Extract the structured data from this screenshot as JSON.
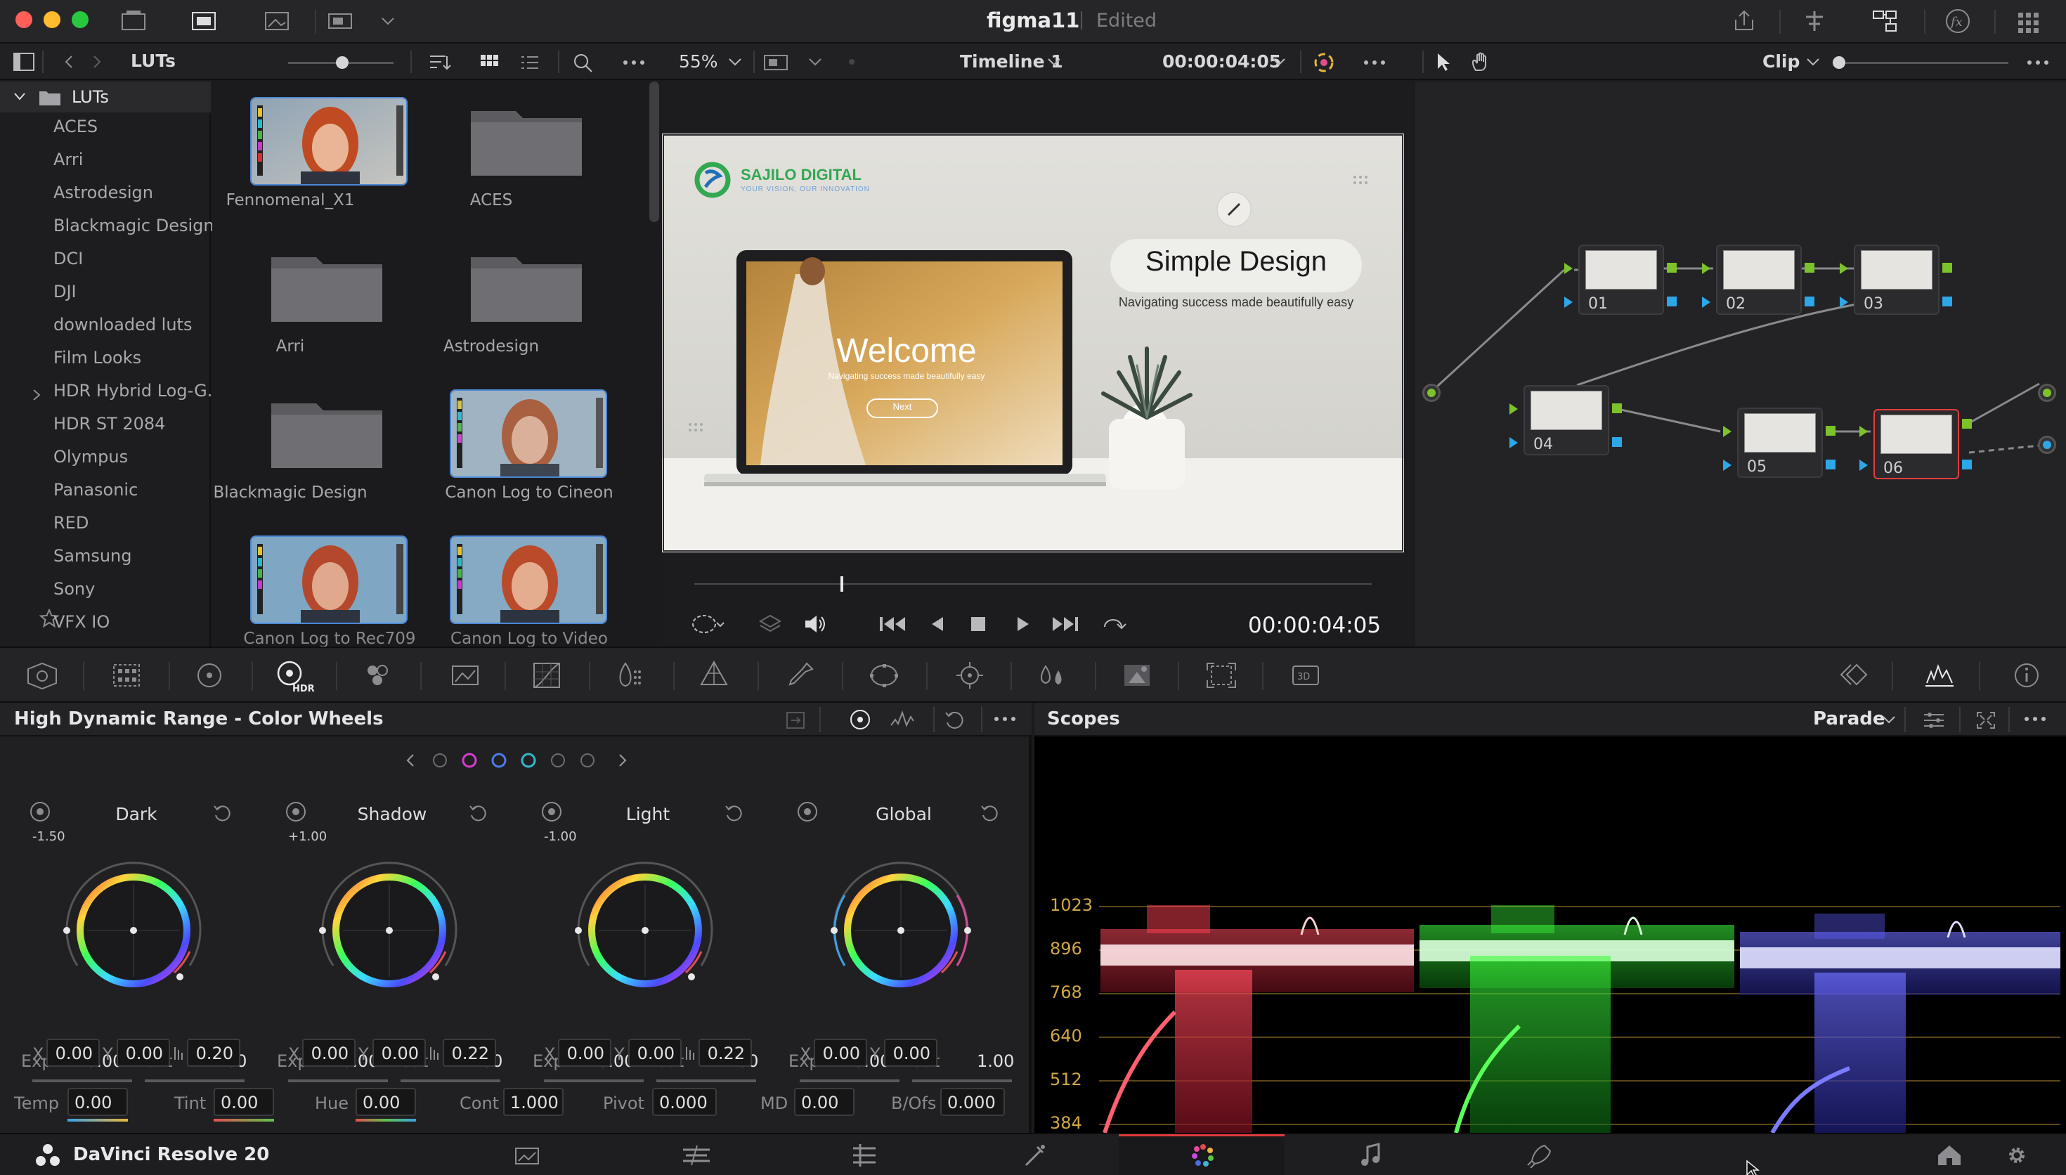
{
  "window": {
    "title": "figma11",
    "status": "Edited"
  },
  "browser": {
    "panel_title": "LUTs",
    "tree_root": "LUTs",
    "tree_items": [
      "ACES",
      "Arri",
      "Astrodesign",
      "Blackmagic Design",
      "DCI",
      "DJI",
      "downloaded luts",
      "Film Looks",
      "HDR Hybrid Log-G...",
      "HDR ST 2084",
      "Olympus",
      "Panasonic",
      "RED",
      "Samsung",
      "Sony",
      "VFX IO",
      "Favorites"
    ],
    "grid_items": [
      "Fennomenal_X1",
      "ACES",
      "Arri",
      "Astrodesign",
      "Blackmagic Design",
      "Canon Log to Cineon",
      "Canon Log to Rec709",
      "Canon Log to Video"
    ]
  },
  "viewer": {
    "zoom": "55%",
    "timeline": "Timeline 1",
    "timecode": "00:00:04:05",
    "playback_timecode": "00:00:04:05",
    "frame": {
      "brand": "SAJILO DIGITAL",
      "tagline": "YOUR VISION, OUR INNOVATION",
      "headline": "Simple Design",
      "subline": "Navigating success made beautifully easy",
      "screen_title": "Welcome",
      "screen_sub": "Navigating success made beautifully easy",
      "screen_button": "Next"
    }
  },
  "nodes": {
    "mode": "Clip",
    "items": [
      "01",
      "02",
      "03",
      "04",
      "05",
      "06"
    ]
  },
  "color_wheels": {
    "title": "High Dynamic Range - Color Wheels",
    "zones": [
      {
        "name": "Dark",
        "range": "-1.50",
        "exp": "0.00",
        "sat": "1.00",
        "x": "0.00",
        "y": "0.00",
        "z": "0.20"
      },
      {
        "name": "Shadow",
        "range": "+1.00",
        "exp": "0.00",
        "sat": "1.00",
        "x": "0.00",
        "y": "0.00",
        "z": "0.22"
      },
      {
        "name": "Light",
        "range": "-1.00",
        "exp": "0.00",
        "sat": "1.00",
        "x": "0.00",
        "y": "0.00",
        "z": "0.22"
      },
      {
        "name": "Global",
        "range": "",
        "exp": "0.00",
        "sat": "1.00",
        "x": "0.00",
        "y": "0.00",
        "z": ""
      }
    ],
    "labels": {
      "exp": "Exp",
      "sat": "Sat",
      "x": "X",
      "y": "Y"
    },
    "bottom": [
      {
        "label": "Temp",
        "value": "0.00"
      },
      {
        "label": "Tint",
        "value": "0.00"
      },
      {
        "label": "Hue",
        "value": "0.00"
      },
      {
        "label": "Cont",
        "value": "1.000"
      },
      {
        "label": "Pivot",
        "value": "0.000"
      },
      {
        "label": "MD",
        "value": "0.00"
      },
      {
        "label": "B/Ofs",
        "value": "0.000"
      }
    ]
  },
  "scopes": {
    "title": "Scopes",
    "mode": "Parade",
    "scale": [
      "1023",
      "896",
      "768",
      "640",
      "512",
      "384"
    ]
  },
  "app": {
    "name": "DaVinci Resolve 20"
  },
  "colors": {
    "accent": "#e43b3b",
    "node_green": "#7cc22a",
    "node_blue": "#2da7e8",
    "scope_axis": "#d1a646"
  }
}
